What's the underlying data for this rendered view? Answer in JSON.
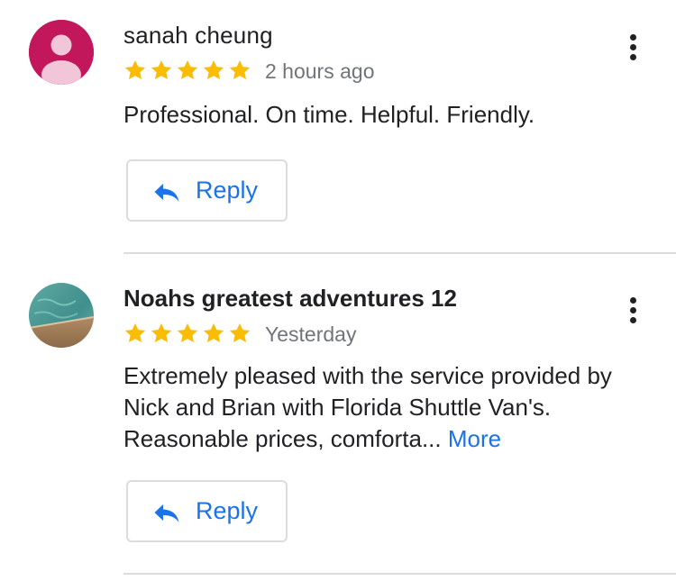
{
  "colors": {
    "star": "#fbbc04",
    "link": "#1a73e8",
    "text": "#202124",
    "muted": "#70757a",
    "avatar_1": "#c2185b"
  },
  "reviews": [
    {
      "author": "sanah cheung",
      "rating": 5,
      "time": "2 hours ago",
      "text": "Professional. On time. Helpful. Friendly.",
      "reply_label": "Reply",
      "avatar_icon": "person-silhouette-icon",
      "menu_icon": "more-vert-icon"
    },
    {
      "author": "Noahs greatest adventures 12",
      "rating": 5,
      "time": "Yesterday",
      "text": "Extremely pleased with the service provided by Nick and Brian with Florida Shuttle Van's. Reasonable prices, comforta...",
      "more_label": "More",
      "reply_label": "Reply",
      "avatar_icon": "photo-avatar-icon",
      "menu_icon": "more-vert-icon"
    }
  ]
}
